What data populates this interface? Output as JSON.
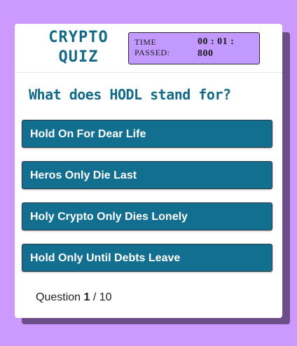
{
  "header": {
    "title_line1": "CRYPTO",
    "title_line2": "QUIZ",
    "timer_label_line1": "TIME",
    "timer_label_line2": "PASSED:",
    "timer_value_line1": "00 : 01 :",
    "timer_value_line2": "800"
  },
  "quiz": {
    "question": "What does HODL stand for?",
    "answers": [
      "Hold On For Dear Life",
      "Heros Only Die Last",
      "Holy Crypto Only Dies Lonely",
      "Hold Only Until Debts Leave"
    ],
    "counter_prefix": "Question",
    "current": "1",
    "separator": "/",
    "total": "10"
  },
  "colors": {
    "background": "#cc99ff",
    "accent": "#136a87",
    "timer_bg": "#c299ff"
  }
}
